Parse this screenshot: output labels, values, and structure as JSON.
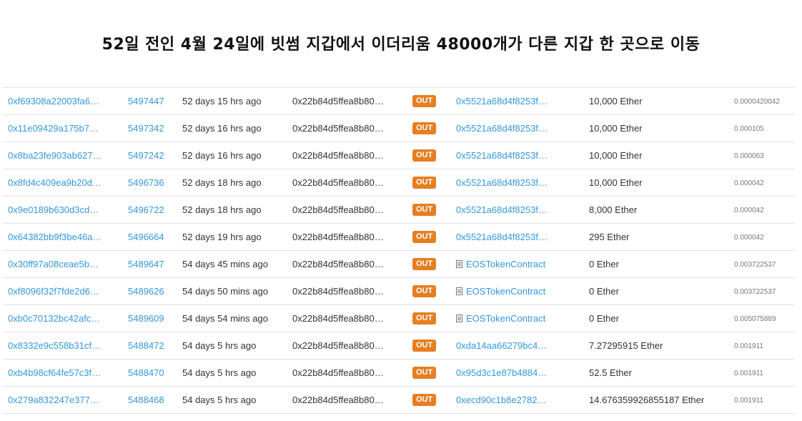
{
  "headline": "52일 전인 4월 24일에 빗썸 지갑에서 이더리움 48000개가 다른 지갑 한 곳으로 이동",
  "colors": {
    "link": "#3498db",
    "out_badge": "#e67e22",
    "border": "#e3e3e3"
  },
  "transactions": [
    {
      "hash": "0xf69308a22003fa6…",
      "block": "5497447",
      "age": "52 days 15 hrs ago",
      "from": "0x22b84d5ffea8b80…",
      "direction": "OUT",
      "to": "0x5521a68d4f8253f…",
      "to_is_contract": false,
      "value": "10,000 Ether",
      "fee": "0.0000420042"
    },
    {
      "hash": "0x11e09429a175b7…",
      "block": "5497342",
      "age": "52 days 16 hrs ago",
      "from": "0x22b84d5ffea8b80…",
      "direction": "OUT",
      "to": "0x5521a68d4f8253f…",
      "to_is_contract": false,
      "value": "10,000 Ether",
      "fee": "0.000105"
    },
    {
      "hash": "0x8ba23fe903ab627…",
      "block": "5497242",
      "age": "52 days 16 hrs ago",
      "from": "0x22b84d5ffea8b80…",
      "direction": "OUT",
      "to": "0x5521a68d4f8253f…",
      "to_is_contract": false,
      "value": "10,000 Ether",
      "fee": "0.000063"
    },
    {
      "hash": "0x8fd4c409ea9b20d…",
      "block": "5496736",
      "age": "52 days 18 hrs ago",
      "from": "0x22b84d5ffea8b80…",
      "direction": "OUT",
      "to": "0x5521a68d4f8253f…",
      "to_is_contract": false,
      "value": "10,000 Ether",
      "fee": "0.000042"
    },
    {
      "hash": "0x9e0189b630d3cd…",
      "block": "5496722",
      "age": "52 days 18 hrs ago",
      "from": "0x22b84d5ffea8b80…",
      "direction": "OUT",
      "to": "0x5521a68d4f8253f…",
      "to_is_contract": false,
      "value": "8,000 Ether",
      "fee": "0.000042"
    },
    {
      "hash": "0x64382bb9f3be46a…",
      "block": "5496664",
      "age": "52 days 19 hrs ago",
      "from": "0x22b84d5ffea8b80…",
      "direction": "OUT",
      "to": "0x5521a68d4f8253f…",
      "to_is_contract": false,
      "value": "295 Ether",
      "fee": "0.000042"
    },
    {
      "hash": "0x30ff97a08ceae5b…",
      "block": "5489647",
      "age": "54 days 45 mins ago",
      "from": "0x22b84d5ffea8b80…",
      "direction": "OUT",
      "to": "EOSTokenContract",
      "to_is_contract": true,
      "value": "0 Ether",
      "fee": "0.003722537"
    },
    {
      "hash": "0xf8096f32f7fde2d6…",
      "block": "5489626",
      "age": "54 days 50 mins ago",
      "from": "0x22b84d5ffea8b80…",
      "direction": "OUT",
      "to": "EOSTokenContract",
      "to_is_contract": true,
      "value": "0 Ether",
      "fee": "0.003722537"
    },
    {
      "hash": "0xb0c70132bc42afc…",
      "block": "5489609",
      "age": "54 days 54 mins ago",
      "from": "0x22b84d5ffea8b80…",
      "direction": "OUT",
      "to": "EOSTokenContract",
      "to_is_contract": true,
      "value": "0 Ether",
      "fee": "0.005075889"
    },
    {
      "hash": "0x8332e9c558b31cf…",
      "block": "5488472",
      "age": "54 days 5 hrs ago",
      "from": "0x22b84d5ffea8b80…",
      "direction": "OUT",
      "to": "0xda14aa66279bc4…",
      "to_is_contract": false,
      "value": "7.27295915 Ether",
      "fee": "0.001911"
    },
    {
      "hash": "0xb4b98cf64fe57c3f…",
      "block": "5488470",
      "age": "54 days 5 hrs ago",
      "from": "0x22b84d5ffea8b80…",
      "direction": "OUT",
      "to": "0x95d3c1e87b4884…",
      "to_is_contract": false,
      "value": "52.5 Ether",
      "fee": "0.001911"
    },
    {
      "hash": "0x279a832247e377…",
      "block": "5488468",
      "age": "54 days 5 hrs ago",
      "from": "0x22b84d5ffea8b80…",
      "direction": "OUT",
      "to": "0xecd90c1b8e2782…",
      "to_is_contract": false,
      "value": "14.676359926855187 Ether",
      "fee": "0.001911"
    }
  ]
}
